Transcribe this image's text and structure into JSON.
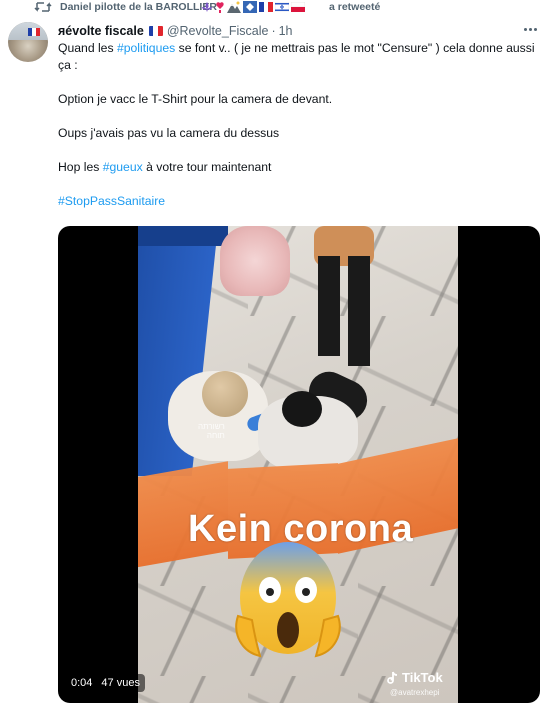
{
  "retweet": {
    "label": "Daniel pilotte de la BAROLLIER",
    "suffix": "a retweeté"
  },
  "tweet": {
    "display_name": "яévolte fiscale",
    "handle": "@Revolte_Fiscale",
    "time": "1h",
    "line1_pre": "Quand les ",
    "line1_tag": "#politiques",
    "line1_post": " se font v.. ( je ne mettrais pas le mot \"Censure\" ) cela donne aussi ça :",
    "line2": "Option je vacc le T-Shirt pour la camera de devant.",
    "line3": "Oups j'avais pas vu la camera du dessus",
    "line4_pre": "Hop les ",
    "line4_tag": "#gueux",
    "line4_post": " à votre tour maintenant",
    "line5_tag": "#StopPassSanitaire"
  },
  "media": {
    "overlay_text": "Kein corona",
    "tiktok_brand": "TikTok",
    "tiktok_user": "@avatrexhepi",
    "hebrew_caption": "רשורתה\nתוחה",
    "duration": "0:04",
    "views": "47 vues"
  },
  "colors": {
    "link": "#1d9bf0",
    "secondary_text": "#536471",
    "overlay_orange": "#e86f2c",
    "glove_blue": "#3a7fd8"
  },
  "icons": {
    "retweet": "retweet-icon",
    "more": "more-icon",
    "tiktok": "tiktok-icon",
    "emoji": "face-screaming-in-fear-emoji"
  }
}
